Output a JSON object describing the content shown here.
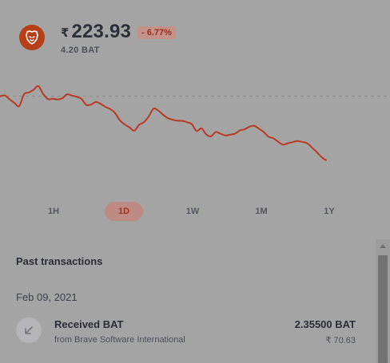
{
  "asset": {
    "logo_icon": "brave-lion-icon",
    "currency_symbol": "₹",
    "price": "223.93",
    "change": "- 6.77%",
    "balance": "4.20 BAT"
  },
  "chart_data": {
    "type": "line",
    "title": "",
    "xlabel": "",
    "ylabel": "",
    "x": [
      0,
      6,
      12,
      18,
      24,
      30,
      36,
      42,
      48,
      54,
      60,
      66,
      72,
      78,
      84,
      90,
      96,
      102,
      108,
      114,
      120,
      126,
      132,
      138,
      144,
      150,
      156,
      162,
      168,
      174,
      180,
      186,
      192,
      198,
      204,
      210,
      216,
      222,
      228,
      234,
      240,
      246,
      252,
      258,
      264,
      270,
      276,
      282,
      288,
      294,
      300,
      306,
      312,
      318,
      324,
      330,
      336,
      342,
      348,
      354,
      360,
      366,
      372,
      378,
      384,
      390,
      396,
      402,
      408,
      414,
      420,
      426,
      432,
      438,
      444,
      450,
      456,
      462,
      468,
      474,
      480,
      486
    ],
    "values": [
      0.0,
      0.5,
      -1.8,
      -4.0,
      -5.9,
      1.2,
      2.3,
      3.9,
      6.1,
      1.4,
      -1.7,
      -1.5,
      -1.9,
      -1.2,
      1.2,
      0.4,
      -0.3,
      -1.6,
      -5.2,
      -5.0,
      -3.4,
      -4.6,
      -6.4,
      -7.7,
      -10.1,
      -14.5,
      -16.9,
      -18.7,
      -20.7,
      -17.2,
      -15.6,
      -12.2,
      -7.5,
      -8.6,
      -11.1,
      -13.1,
      -14.1,
      -14.7,
      -14.8,
      -15.6,
      -16.8,
      -20.9,
      -19.3,
      -22.9,
      -24.1,
      -21.5,
      -22.5,
      -23.6,
      -23.1,
      -22.5,
      -20.6,
      -19.9,
      -18.3,
      -17.8,
      -19.5,
      -21.5,
      -24.3,
      -25.3,
      -27.3,
      -29.1,
      -28.3,
      -27.6,
      -26.9,
      -27.5,
      -28.2,
      -30.7,
      -33.4,
      -36.4,
      -38.4,
      -37.2
    ],
    "reference_line": 0,
    "line_color": "#b83a23",
    "reference_color": "#8a8a8a",
    "grid": false,
    "legend": "none"
  },
  "timeframes": {
    "items": [
      "1H",
      "1D",
      "1W",
      "1M",
      "1Y"
    ],
    "active": "1D"
  },
  "transactions": {
    "heading": "Past transactions",
    "groups": [
      {
        "date": "Feb 09, 2021",
        "items": [
          {
            "icon": "arrow-down-left-icon",
            "title": "Received BAT",
            "subtitle": "from Brave Software International",
            "amount": "2.35500 BAT",
            "fiat": "₹ 70.63"
          }
        ]
      }
    ]
  }
}
